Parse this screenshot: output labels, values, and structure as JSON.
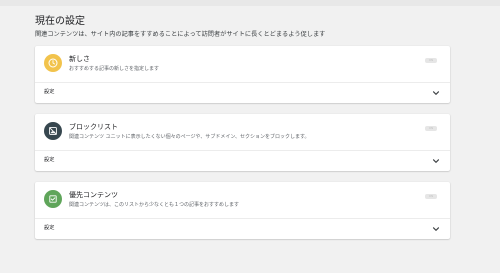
{
  "header": {
    "title": "現在の設定",
    "description": "関連コンテンツは、サイト内の記事をすすめることによって訪問者がサイトに長くとどまるよう促します"
  },
  "cards": [
    {
      "title": "新しさ",
      "subtitle": "おすすめする記事の新しさを指定します",
      "toggle_label": "ON",
      "settings_label": "設定",
      "icon": "clock-icon",
      "icon_color": "#f2c34c"
    },
    {
      "title": "ブロックリスト",
      "subtitle": "関連コンテンツ ユニットに表示したくない個々のページや、サブドメイン、セクションをブロックします。",
      "toggle_label": "ON",
      "settings_label": "設定",
      "icon": "block-image-icon",
      "icon_color": "#37474f"
    },
    {
      "title": "優先コンテンツ",
      "subtitle": "関連コンテンツは、このリストから少なくとも１つの記事をおすすめします",
      "toggle_label": "ON",
      "settings_label": "設定",
      "icon": "checkbox-icon",
      "icon_color": "#5fa55a"
    }
  ]
}
